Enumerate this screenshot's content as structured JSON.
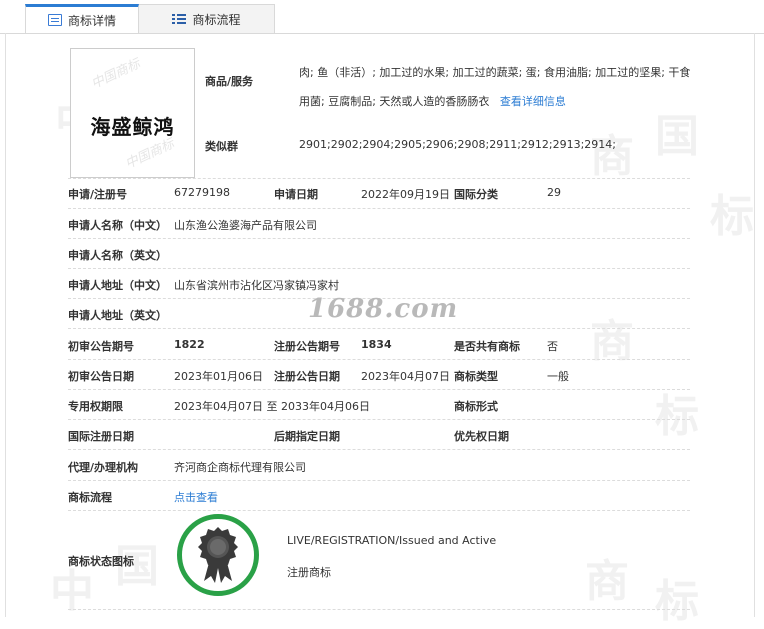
{
  "tabs": {
    "detail": "商标详情",
    "flow": "商标流程"
  },
  "watermark": {
    "chars": [
      "中",
      "国",
      "商",
      "标"
    ]
  },
  "logo": {
    "text": "海盛鲸鸿",
    "watermark": "中国商标"
  },
  "goods": {
    "label": "商品/服务",
    "text": "肉; 鱼（非活）; 加工过的水果; 加工过的蔬菜; 蛋; 食用油脂; 加工过的坚果; 干食用菌; 豆腐制品; 天然或人造的香肠肠衣",
    "link": "查看详细信息"
  },
  "similar": {
    "label": "类似群",
    "value": "2901;2902;2904;2905;2906;2908;2911;2912;2913;2914;"
  },
  "reg_no": {
    "label": "申请/注册号",
    "value": "67279198"
  },
  "app_date": {
    "label": "申请日期",
    "value": "2022年09月19日"
  },
  "intl_class": {
    "label": "国际分类",
    "value": "29"
  },
  "applicant_cn": {
    "label": "申请人名称（中文）",
    "value": "山东渔公渔婆海产品有限公司"
  },
  "applicant_en": {
    "label": "申请人名称（英文）",
    "value": ""
  },
  "address_cn": {
    "label": "申请人地址（中文）",
    "value": "山东省滨州市沾化区冯家镇冯家村"
  },
  "address_en": {
    "label": "申请人地址（英文）",
    "value": ""
  },
  "watermark_brand": "1688.com",
  "prelim_no": {
    "label": "初审公告期号",
    "value": "1822"
  },
  "reg_pub_no": {
    "label": "注册公告期号",
    "value": "1834"
  },
  "shared": {
    "label": "是否共有商标",
    "value": "否"
  },
  "prelim_date": {
    "label": "初审公告日期",
    "value": "2023年01月06日"
  },
  "reg_pub_date": {
    "label": "注册公告日期",
    "value": "2023年04月07日"
  },
  "mark_type": {
    "label": "商标类型",
    "value": "一般"
  },
  "exclusive": {
    "label": "专用权期限",
    "value": "2023年04月07日 至 2033年04月06日"
  },
  "mark_form": {
    "label": "商标形式",
    "value": ""
  },
  "intl_reg_date": {
    "label": "国际注册日期",
    "value": ""
  },
  "later_date": {
    "label": "后期指定日期",
    "value": ""
  },
  "priority_date": {
    "label": "优先权日期",
    "value": ""
  },
  "agent": {
    "label": "代理/办理机构",
    "value": "齐河商企商标代理有限公司"
  },
  "flow": {
    "label": "商标流程",
    "link": "点击查看"
  },
  "status": {
    "label": "商标状态图标",
    "en": "LIVE/REGISTRATION/Issued and Active",
    "cn": "注册商标"
  },
  "colors": {
    "accent": "#2b7cd3",
    "badge_green": "#2aa147"
  }
}
